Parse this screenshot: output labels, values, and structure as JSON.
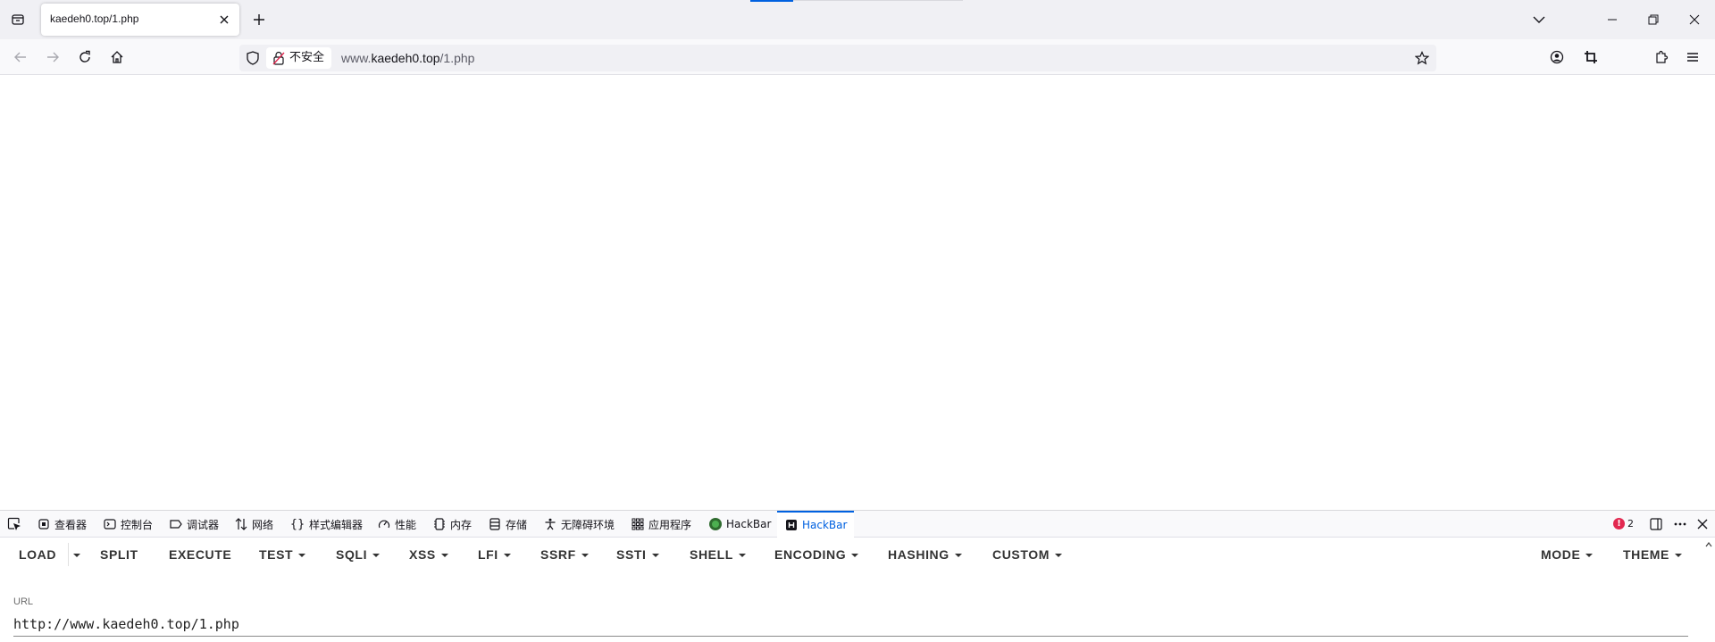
{
  "browser": {
    "tab": {
      "title": "kaedeh0.top/1.php"
    },
    "urlbar": {
      "security_label": "不安全",
      "url_prefix": "www.",
      "url_host": "kaedeh0.top",
      "url_path": "/1.php"
    },
    "icons": {
      "list_all_tabs": "list-all-tabs-icon",
      "close_tab": "close-icon",
      "new_tab": "plus-icon",
      "back": "arrow-left-icon",
      "forward": "arrow-right-icon",
      "reload": "reload-icon",
      "home": "home-icon",
      "bookmark": "star-icon",
      "account": "account-icon",
      "screenshot": "crop-icon",
      "extensions": "puzzle-icon",
      "menu": "hamburger-icon"
    }
  },
  "devtools": {
    "tabs": [
      {
        "label": "查看器",
        "icon": "inspector-icon"
      },
      {
        "label": "控制台",
        "icon": "console-icon"
      },
      {
        "label": "调试器",
        "icon": "debugger-icon"
      },
      {
        "label": "网络",
        "icon": "network-icon"
      },
      {
        "label": "样式编辑器",
        "icon": "style-editor-icon"
      },
      {
        "label": "性能",
        "icon": "performance-icon"
      },
      {
        "label": "内存",
        "icon": "memory-icon"
      },
      {
        "label": "存储",
        "icon": "storage-icon"
      },
      {
        "label": "无障碍环境",
        "icon": "accessibility-icon"
      },
      {
        "label": "应用程序",
        "icon": "application-icon"
      },
      {
        "label": "HackBar",
        "icon": "hackbar-green-icon"
      },
      {
        "label": "HackBar",
        "icon": "hackbar-icon",
        "active": true
      }
    ],
    "error_count": "2",
    "accent": "#0061e0",
    "error_color": "#e22850"
  },
  "hackbar": {
    "buttons": {
      "load": "LOAD",
      "split": "SPLIT",
      "execute": "EXECUTE",
      "test": "TEST",
      "sqli": "SQLI",
      "xss": "XSS",
      "lfi": "LFI",
      "ssrf": "SSRF",
      "ssti": "SSTI",
      "shell": "SHELL",
      "encoding": "ENCODING",
      "hashing": "HASHING",
      "custom": "CUSTOM",
      "mode": "MODE",
      "theme": "THEME"
    },
    "url_label": "URL",
    "url_value": "http://www.kaedeh0.top/1.php"
  }
}
